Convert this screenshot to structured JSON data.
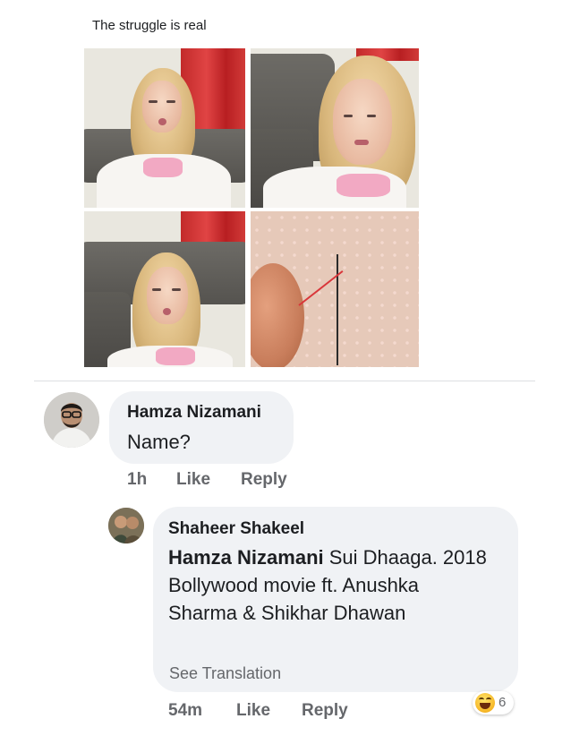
{
  "post": {
    "text": "The struggle is real",
    "images": [
      "photo-1",
      "photo-2",
      "photo-3",
      "photo-4-needle-thread"
    ]
  },
  "comments": [
    {
      "author": "Hamza Nizamani",
      "text": "Name?",
      "time": "1h",
      "like_label": "Like",
      "reply_label": "Reply"
    }
  ],
  "reply": {
    "author": "Shaheer Shakeel",
    "mention": "Hamza Nizamani",
    "text": " Sui Dhaaga. 2018 Bollywood movie ft. Anushka Sharma & Shikhar Dhawan",
    "see_translation": "See Translation",
    "time": "54m",
    "like_label": "Like",
    "reply_label": "Reply",
    "reaction": {
      "icon": "haha-emoji-icon",
      "count": "6"
    }
  },
  "colors": {
    "bubble": "#f0f2f5",
    "text": "#1c1e21",
    "meta": "#65676b"
  }
}
